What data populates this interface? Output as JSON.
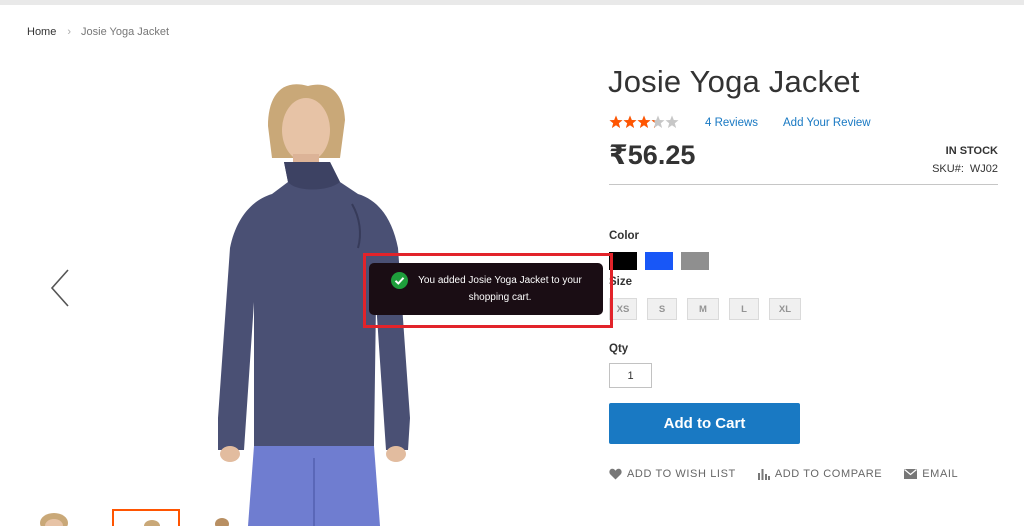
{
  "breadcrumbs": {
    "home": "Home",
    "separator": "›",
    "current": "Josie Yoga Jacket"
  },
  "product": {
    "title": "Josie Yoga Jacket",
    "rating_fraction": 0.65,
    "reviews_link": "4 Reviews",
    "add_review_link": "Add Your Review",
    "price": "₹56.25",
    "stock": "IN STOCK",
    "sku_label": "SKU#:",
    "sku_value": "WJ02"
  },
  "options": {
    "color_label": "Color",
    "colors": [
      {
        "name": "black",
        "hex": "#000000"
      },
      {
        "name": "blue",
        "hex": "#1857f7"
      },
      {
        "name": "gray",
        "hex": "#8f8f8f"
      }
    ],
    "size_label": "Size",
    "sizes": [
      "XS",
      "S",
      "M",
      "L",
      "XL"
    ],
    "qty_label": "Qty",
    "qty_value": "1"
  },
  "buttons": {
    "add_to_cart": "Add to Cart"
  },
  "actions": {
    "wishlist": "ADD TO WISH LIST",
    "compare": "ADD TO COMPARE",
    "email": "EMAIL"
  },
  "toast": {
    "message": "You added Josie Yoga Jacket to your shopping cart.",
    "icon": "check-circle-icon"
  },
  "colors": {
    "accent_link": "#1979c3",
    "button_bg": "#1979c3",
    "star_on": "#ff5501",
    "highlight_border": "#e2232a",
    "toast_bg": "#1a0d14"
  }
}
